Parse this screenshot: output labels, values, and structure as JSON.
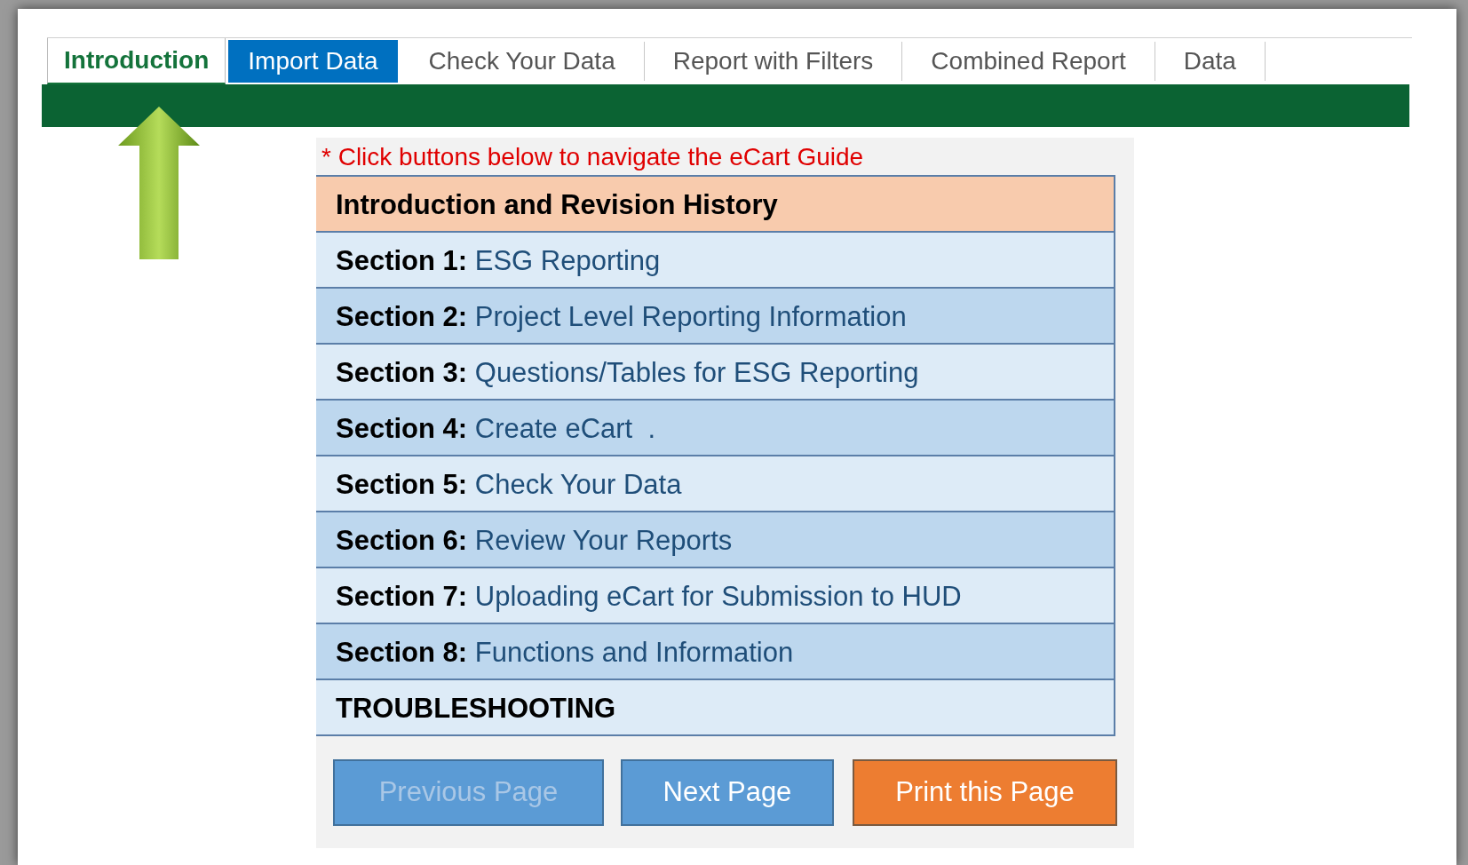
{
  "tabs": [
    {
      "label": "Introduction",
      "selected": true,
      "highlighted": false
    },
    {
      "label": "Import Data",
      "selected": false,
      "highlighted": true
    },
    {
      "label": "Check Your Data",
      "selected": false,
      "highlighted": false
    },
    {
      "label": "Report with Filters",
      "selected": false,
      "highlighted": false
    },
    {
      "label": "Combined Report",
      "selected": false,
      "highlighted": false
    },
    {
      "label": "Data",
      "selected": false,
      "highlighted": false
    }
  ],
  "note": "* Click buttons below to navigate the eCart Guide",
  "menu": [
    {
      "kind": "header",
      "title": "Introduction and Revision History"
    },
    {
      "kind": "section",
      "label": "Section 1:",
      "title": "ESG Reporting"
    },
    {
      "kind": "section",
      "label": "Section 2:",
      "title": "Project Level Reporting Information"
    },
    {
      "kind": "section",
      "label": "Section 3:",
      "title": "Questions/Tables for ESG Reporting"
    },
    {
      "kind": "section",
      "label": "Section 4:",
      "title": "Create eCart  ."
    },
    {
      "kind": "section",
      "label": "Section 5:",
      "title": "Check Your Data"
    },
    {
      "kind": "section",
      "label": "Section 6:",
      "title": "Review Your Reports"
    },
    {
      "kind": "section",
      "label": "Section 7:",
      "title": "Uploading eCart for Submission to HUD"
    },
    {
      "kind": "section",
      "label": "Section 8:",
      "title": "Functions and Information"
    },
    {
      "kind": "plain",
      "title": "TROUBLESHOOTING"
    }
  ],
  "buttons": [
    {
      "label": "Previous Page",
      "kind": "nav",
      "disabled": true
    },
    {
      "label": "Next Page",
      "kind": "nav",
      "disabled": false
    },
    {
      "label": "Print this Page",
      "kind": "print",
      "disabled": false
    }
  ]
}
